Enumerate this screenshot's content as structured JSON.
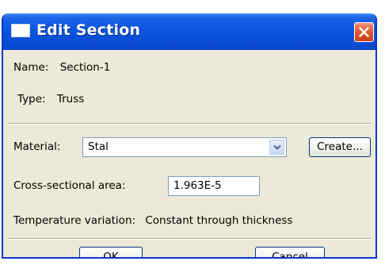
{
  "window": {
    "title": "Edit Section"
  },
  "info": {
    "name_label": "Name:",
    "name_value": "Section-1",
    "type_label": "Type:",
    "type_value": "Truss"
  },
  "material": {
    "label": "Material:",
    "selected": "Stal",
    "create_label": "Create..."
  },
  "area": {
    "label": "Cross-sectional area:",
    "value": "1.963E-5"
  },
  "temperature": {
    "label": "Temperature variation:",
    "value": "Constant through thickness"
  },
  "buttons": {
    "ok": "OK",
    "cancel": "Cancel"
  },
  "icons": {
    "window": "window-icon",
    "close": "close-icon",
    "dropdown": "chevron-down-icon"
  },
  "colors": {
    "titlebar": "#0a55e0",
    "close": "#e25a2f",
    "dialog_bg": "#ece9d8"
  }
}
